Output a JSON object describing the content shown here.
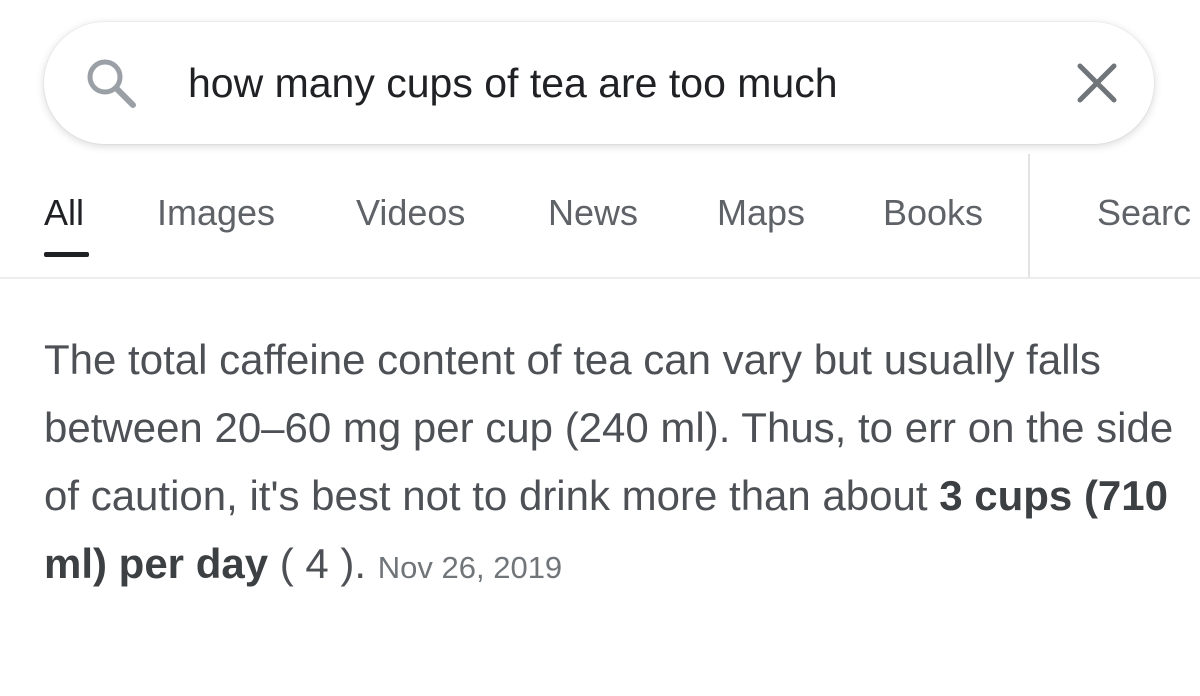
{
  "search": {
    "query": "how many cups of tea are too much"
  },
  "tabs": [
    {
      "label": "All",
      "active": true
    },
    {
      "label": "Images",
      "active": false
    },
    {
      "label": "Videos",
      "active": false
    },
    {
      "label": "News",
      "active": false
    },
    {
      "label": "Maps",
      "active": false
    },
    {
      "label": "Books",
      "active": false
    },
    {
      "label": "Searc",
      "active": false
    }
  ],
  "snippet": {
    "text_part1": "The total caffeine content of tea can vary but usually falls between 20–60 mg per cup (240 ml). Thus, to err on the side of caution, it's best not to drink more than about ",
    "highlight": "3 cups (710 ml) per day",
    "citation": " ( 4 ).",
    "date": "Nov 26, 2019"
  },
  "colors": {
    "text_primary": "#202124",
    "text_secondary": "#5f6368",
    "snippet_text": "#4d5156",
    "date_text": "#70757a"
  },
  "icons": {
    "search": "search-icon",
    "clear": "close-icon"
  }
}
